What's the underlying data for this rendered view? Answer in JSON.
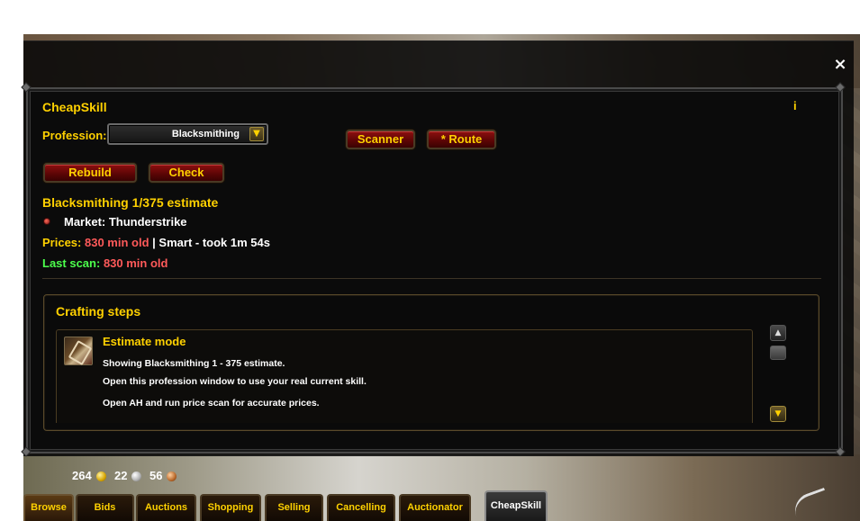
{
  "window": {
    "close_label": "×"
  },
  "cheapskill": {
    "title": "CheapSkill",
    "info_label": "i",
    "profession_label": "Profession:",
    "profession_value": "Blacksmithing",
    "buttons": {
      "scanner": "Scanner",
      "route": "* Route",
      "rebuild": "Rebuild",
      "check": "Check"
    },
    "estimate_heading": "Blacksmithing 1/375 estimate",
    "market_text": "Market: Thunderstrike",
    "prices_label": "Prices:",
    "prices_age": "830 min old",
    "prices_separator": "|",
    "prices_mode": "Smart - took 1m 54s",
    "last_scan_label": "Last scan:",
    "last_scan_age": "830 min old",
    "crafting_steps": {
      "heading": "Crafting steps",
      "step": {
        "title": "Estimate mode",
        "lines": [
          "Showing Blacksmithing 1 - 375 estimate.",
          "Open this profession window to use your real current skill.",
          "Open AH and run price scan for accurate prices."
        ]
      }
    }
  },
  "money": {
    "gold": "264",
    "silver": "22",
    "copper": "56"
  },
  "tabs": [
    {
      "label": "Browse"
    },
    {
      "label": "Bids"
    },
    {
      "label": "Auctions"
    },
    {
      "label": "Shopping"
    },
    {
      "label": "Selling"
    },
    {
      "label": "Cancelling"
    },
    {
      "label": "Auctionator"
    },
    {
      "label": "CheapSkill"
    }
  ],
  "colors": {
    "gold_text": "#ffd100",
    "red_value": "#ff5a5a",
    "green_label": "#4cff4c",
    "button_red": "#8e0f0f"
  }
}
